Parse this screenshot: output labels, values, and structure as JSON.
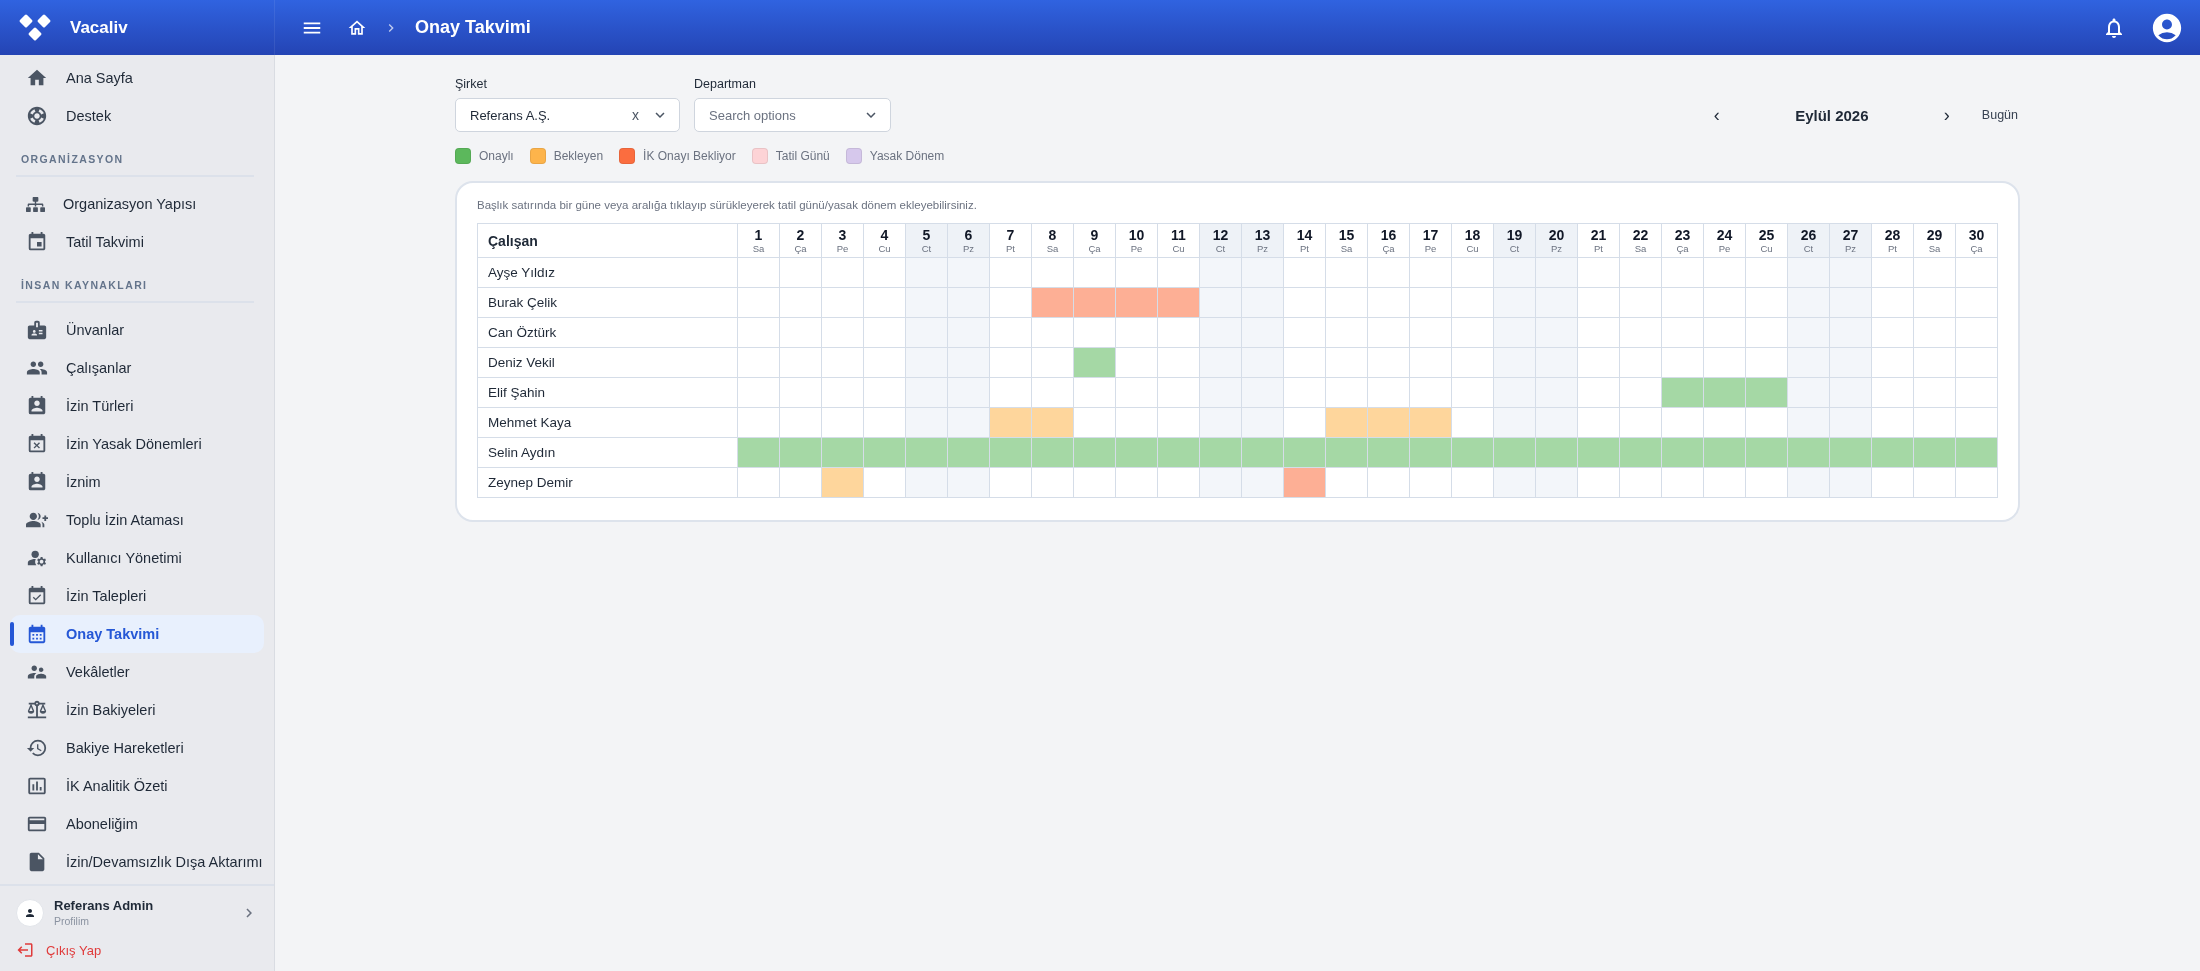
{
  "topbar": {
    "brand": "Vacaliv",
    "page_title": "Onay Takvimi"
  },
  "sidebar": {
    "sections": [
      {
        "items": [
          {
            "label": "Ana Sayfa",
            "selected": false
          },
          {
            "label": "Destek",
            "selected": false
          }
        ]
      },
      {
        "title": "ORGANİZASYON",
        "items": [
          {
            "label": "Organizasyon Yapısı",
            "selected": false
          },
          {
            "label": "Tatil Takvimi",
            "selected": false
          }
        ]
      },
      {
        "title": "İNSAN KAYNAKLARI",
        "items": [
          {
            "label": "Ünvanlar",
            "selected": false
          },
          {
            "label": "Çalışanlar",
            "selected": false
          },
          {
            "label": "İzin Türleri",
            "selected": false
          },
          {
            "label": "İzin Yasak Dönemleri",
            "selected": false
          },
          {
            "label": "İznim",
            "selected": false
          },
          {
            "label": "Toplu İzin Ataması",
            "selected": false
          },
          {
            "label": "Kullanıcı Yönetimi",
            "selected": false
          },
          {
            "label": "İzin Talepleri",
            "selected": false
          },
          {
            "label": "Onay Takvimi",
            "selected": true
          },
          {
            "label": "Vekâletler",
            "selected": false
          },
          {
            "label": "İzin Bakiyeleri",
            "selected": false
          },
          {
            "label": "Bakiye Hareketleri",
            "selected": false
          },
          {
            "label": "İK Analitik Özeti",
            "selected": false
          },
          {
            "label": "Aboneliğim",
            "selected": false
          },
          {
            "label": "İzin/Devamsızlık Dışa Aktarımı",
            "selected": false
          }
        ]
      }
    ],
    "profile": {
      "name": "Referans Admin",
      "subtitle": "Profilim"
    },
    "logout": "Çıkış Yap"
  },
  "filters": {
    "company": {
      "label": "Şirket",
      "value": "Referans A.Ş.",
      "clear": "x"
    },
    "department": {
      "label": "Departman",
      "placeholder": "Search options"
    }
  },
  "month_nav": {
    "prev": "‹",
    "title": "Eylül 2026",
    "next": "›",
    "today": "Bugün"
  },
  "legend": [
    {
      "label": "Onaylı",
      "kind": "approved",
      "color": "#5cb85c"
    },
    {
      "label": "Bekleyen",
      "kind": "pending",
      "color": "#fdb44b"
    },
    {
      "label": "İK Onayı Bekliyor",
      "kind": "hr_pending",
      "color": "#fb6d3f"
    },
    {
      "label": "Tatil Günü",
      "kind": "holiday",
      "color": "#fdd3d6"
    },
    {
      "label": "Yasak Dönem",
      "kind": "blackout",
      "color": "#d6c8ec"
    }
  ],
  "calendar": {
    "hint": "Başlık satırında bir güne veya aralığa tıklayıp sürükleyerek tatil günü/yasak dönem ekleyebilirsiniz.",
    "name_header": "Çalışan",
    "days": [
      {
        "number": "1",
        "weekday": "Sa",
        "weekend": false
      },
      {
        "number": "2",
        "weekday": "Ça",
        "weekend": false
      },
      {
        "number": "3",
        "weekday": "Pe",
        "weekend": false
      },
      {
        "number": "4",
        "weekday": "Cu",
        "weekend": false
      },
      {
        "number": "5",
        "weekday": "Ct",
        "weekend": true
      },
      {
        "number": "6",
        "weekday": "Pz",
        "weekend": true
      },
      {
        "number": "7",
        "weekday": "Pt",
        "weekend": false
      },
      {
        "number": "8",
        "weekday": "Sa",
        "weekend": false
      },
      {
        "number": "9",
        "weekday": "Ça",
        "weekend": false
      },
      {
        "number": "10",
        "weekday": "Pe",
        "weekend": false
      },
      {
        "number": "11",
        "weekday": "Cu",
        "weekend": false
      },
      {
        "number": "12",
        "weekday": "Ct",
        "weekend": true
      },
      {
        "number": "13",
        "weekday": "Pz",
        "weekend": true
      },
      {
        "number": "14",
        "weekday": "Pt",
        "weekend": false
      },
      {
        "number": "15",
        "weekday": "Sa",
        "weekend": false
      },
      {
        "number": "16",
        "weekday": "Ça",
        "weekend": false
      },
      {
        "number": "17",
        "weekday": "Pe",
        "weekend": false
      },
      {
        "number": "18",
        "weekday": "Cu",
        "weekend": false
      },
      {
        "number": "19",
        "weekday": "Ct",
        "weekend": true
      },
      {
        "number": "20",
        "weekday": "Pz",
        "weekend": true
      },
      {
        "number": "21",
        "weekday": "Pt",
        "weekend": false
      },
      {
        "number": "22",
        "weekday": "Sa",
        "weekend": false
      },
      {
        "number": "23",
        "weekday": "Ça",
        "weekend": false
      },
      {
        "number": "24",
        "weekday": "Pe",
        "weekend": false
      },
      {
        "number": "25",
        "weekday": "Cu",
        "weekend": false
      },
      {
        "number": "26",
        "weekday": "Ct",
        "weekend": true
      },
      {
        "number": "27",
        "weekday": "Pz",
        "weekend": true
      },
      {
        "number": "28",
        "weekday": "Pt",
        "weekend": false
      },
      {
        "number": "29",
        "weekday": "Sa",
        "weekend": false
      },
      {
        "number": "30",
        "weekday": "Ça",
        "weekend": false
      }
    ],
    "rows": [
      {
        "name": "Ayşe Yıldız",
        "cells": [
          {
            "kind": "none"
          },
          {
            "kind": "none"
          },
          {
            "kind": "none"
          },
          {
            "kind": "none"
          },
          {
            "kind": "none"
          },
          {
            "kind": "none"
          },
          {
            "kind": "none"
          },
          {
            "kind": "none"
          },
          {
            "kind": "none"
          },
          {
            "kind": "none"
          },
          {
            "kind": "none"
          },
          {
            "kind": "none"
          },
          {
            "kind": "none"
          },
          {
            "kind": "none"
          },
          {
            "kind": "none"
          },
          {
            "kind": "none"
          },
          {
            "kind": "none"
          },
          {
            "kind": "none"
          },
          {
            "kind": "none"
          },
          {
            "kind": "none"
          },
          {
            "kind": "none"
          },
          {
            "kind": "none"
          },
          {
            "kind": "none"
          },
          {
            "kind": "none"
          },
          {
            "kind": "none"
          },
          {
            "kind": "none"
          },
          {
            "kind": "none"
          },
          {
            "kind": "none"
          },
          {
            "kind": "none"
          },
          {
            "kind": "none"
          }
        ]
      },
      {
        "name": "Burak Çelik",
        "cells": [
          {
            "kind": "none"
          },
          {
            "kind": "none"
          },
          {
            "kind": "none"
          },
          {
            "kind": "none"
          },
          {
            "kind": "none"
          },
          {
            "kind": "none"
          },
          {
            "kind": "none"
          },
          {
            "kind": "hr_pending"
          },
          {
            "kind": "hr_pending"
          },
          {
            "kind": "hr_pending"
          },
          {
            "kind": "hr_pending"
          },
          {
            "kind": "none"
          },
          {
            "kind": "none"
          },
          {
            "kind": "none"
          },
          {
            "kind": "none"
          },
          {
            "kind": "none"
          },
          {
            "kind": "none"
          },
          {
            "kind": "none"
          },
          {
            "kind": "none"
          },
          {
            "kind": "none"
          },
          {
            "kind": "none"
          },
          {
            "kind": "none"
          },
          {
            "kind": "none"
          },
          {
            "kind": "none"
          },
          {
            "kind": "none"
          },
          {
            "kind": "none"
          },
          {
            "kind": "none"
          },
          {
            "kind": "none"
          },
          {
            "kind": "none"
          },
          {
            "kind": "none"
          }
        ]
      },
      {
        "name": "Can Öztürk",
        "cells": [
          {
            "kind": "none"
          },
          {
            "kind": "none"
          },
          {
            "kind": "none"
          },
          {
            "kind": "none"
          },
          {
            "kind": "none"
          },
          {
            "kind": "none"
          },
          {
            "kind": "none"
          },
          {
            "kind": "none"
          },
          {
            "kind": "none"
          },
          {
            "kind": "none"
          },
          {
            "kind": "none"
          },
          {
            "kind": "none"
          },
          {
            "kind": "none"
          },
          {
            "kind": "none"
          },
          {
            "kind": "none"
          },
          {
            "kind": "none"
          },
          {
            "kind": "none"
          },
          {
            "kind": "none"
          },
          {
            "kind": "none"
          },
          {
            "kind": "none"
          },
          {
            "kind": "none"
          },
          {
            "kind": "none"
          },
          {
            "kind": "none"
          },
          {
            "kind": "none"
          },
          {
            "kind": "none"
          },
          {
            "kind": "none"
          },
          {
            "kind": "none"
          },
          {
            "kind": "none"
          },
          {
            "kind": "none"
          },
          {
            "kind": "none"
          }
        ]
      },
      {
        "name": "Deniz Vekil",
        "cells": [
          {
            "kind": "none"
          },
          {
            "kind": "none"
          },
          {
            "kind": "none"
          },
          {
            "kind": "none"
          },
          {
            "kind": "none"
          },
          {
            "kind": "none"
          },
          {
            "kind": "none"
          },
          {
            "kind": "none"
          },
          {
            "kind": "approved"
          },
          {
            "kind": "none"
          },
          {
            "kind": "none"
          },
          {
            "kind": "none"
          },
          {
            "kind": "none"
          },
          {
            "kind": "none"
          },
          {
            "kind": "none"
          },
          {
            "kind": "none"
          },
          {
            "kind": "none"
          },
          {
            "kind": "none"
          },
          {
            "kind": "none"
          },
          {
            "kind": "none"
          },
          {
            "kind": "none"
          },
          {
            "kind": "none"
          },
          {
            "kind": "none"
          },
          {
            "kind": "none"
          },
          {
            "kind": "none"
          },
          {
            "kind": "none"
          },
          {
            "kind": "none"
          },
          {
            "kind": "none"
          },
          {
            "kind": "none"
          },
          {
            "kind": "none"
          }
        ]
      },
      {
        "name": "Elif Şahin",
        "cells": [
          {
            "kind": "none"
          },
          {
            "kind": "none"
          },
          {
            "kind": "none"
          },
          {
            "kind": "none"
          },
          {
            "kind": "none"
          },
          {
            "kind": "none"
          },
          {
            "kind": "none"
          },
          {
            "kind": "none"
          },
          {
            "kind": "none"
          },
          {
            "kind": "none"
          },
          {
            "kind": "none"
          },
          {
            "kind": "none"
          },
          {
            "kind": "none"
          },
          {
            "kind": "none"
          },
          {
            "kind": "none"
          },
          {
            "kind": "none"
          },
          {
            "kind": "none"
          },
          {
            "kind": "none"
          },
          {
            "kind": "none"
          },
          {
            "kind": "none"
          },
          {
            "kind": "none"
          },
          {
            "kind": "none"
          },
          {
            "kind": "approved"
          },
          {
            "kind": "approved"
          },
          {
            "kind": "approved"
          },
          {
            "kind": "none"
          },
          {
            "kind": "none"
          },
          {
            "kind": "none"
          },
          {
            "kind": "none"
          },
          {
            "kind": "none"
          }
        ]
      },
      {
        "name": "Mehmet Kaya",
        "cells": [
          {
            "kind": "none"
          },
          {
            "kind": "none"
          },
          {
            "kind": "none"
          },
          {
            "kind": "none"
          },
          {
            "kind": "none"
          },
          {
            "kind": "none"
          },
          {
            "kind": "pending"
          },
          {
            "kind": "pending"
          },
          {
            "kind": "none"
          },
          {
            "kind": "none"
          },
          {
            "kind": "none"
          },
          {
            "kind": "none"
          },
          {
            "kind": "none"
          },
          {
            "kind": "none"
          },
          {
            "kind": "pending"
          },
          {
            "kind": "pending"
          },
          {
            "kind": "pending"
          },
          {
            "kind": "none"
          },
          {
            "kind": "none"
          },
          {
            "kind": "none"
          },
          {
            "kind": "none"
          },
          {
            "kind": "none"
          },
          {
            "kind": "none"
          },
          {
            "kind": "none"
          },
          {
            "kind": "none"
          },
          {
            "kind": "none"
          },
          {
            "kind": "none"
          },
          {
            "kind": "none"
          },
          {
            "kind": "none"
          },
          {
            "kind": "none"
          }
        ]
      },
      {
        "name": "Selin Aydın",
        "cells": [
          {
            "kind": "approved"
          },
          {
            "kind": "approved"
          },
          {
            "kind": "approved"
          },
          {
            "kind": "approved"
          },
          {
            "kind": "approved"
          },
          {
            "kind": "approved"
          },
          {
            "kind": "approved"
          },
          {
            "kind": "approved"
          },
          {
            "kind": "approved"
          },
          {
            "kind": "approved"
          },
          {
            "kind": "approved"
          },
          {
            "kind": "approved"
          },
          {
            "kind": "approved"
          },
          {
            "kind": "approved"
          },
          {
            "kind": "approved"
          },
          {
            "kind": "approved"
          },
          {
            "kind": "approved"
          },
          {
            "kind": "approved"
          },
          {
            "kind": "approved"
          },
          {
            "kind": "approved"
          },
          {
            "kind": "approved"
          },
          {
            "kind": "approved"
          },
          {
            "kind": "approved"
          },
          {
            "kind": "approved"
          },
          {
            "kind": "approved"
          },
          {
            "kind": "approved"
          },
          {
            "kind": "approved"
          },
          {
            "kind": "approved"
          },
          {
            "kind": "approved"
          },
          {
            "kind": "approved"
          }
        ]
      },
      {
        "name": "Zeynep Demir",
        "cells": [
          {
            "kind": "none"
          },
          {
            "kind": "none"
          },
          {
            "kind": "pending"
          },
          {
            "kind": "none"
          },
          {
            "kind": "none"
          },
          {
            "kind": "none"
          },
          {
            "kind": "none"
          },
          {
            "kind": "none"
          },
          {
            "kind": "none"
          },
          {
            "kind": "none"
          },
          {
            "kind": "none"
          },
          {
            "kind": "none"
          },
          {
            "kind": "none"
          },
          {
            "kind": "hr_pending"
          },
          {
            "kind": "none"
          },
          {
            "kind": "none"
          },
          {
            "kind": "none"
          },
          {
            "kind": "none"
          },
          {
            "kind": "none"
          },
          {
            "kind": "none"
          },
          {
            "kind": "none"
          },
          {
            "kind": "none"
          },
          {
            "kind": "none"
          },
          {
            "kind": "none"
          },
          {
            "kind": "none"
          },
          {
            "kind": "none"
          },
          {
            "kind": "none"
          },
          {
            "kind": "none"
          },
          {
            "kind": "none"
          },
          {
            "kind": "none"
          }
        ]
      }
    ]
  }
}
